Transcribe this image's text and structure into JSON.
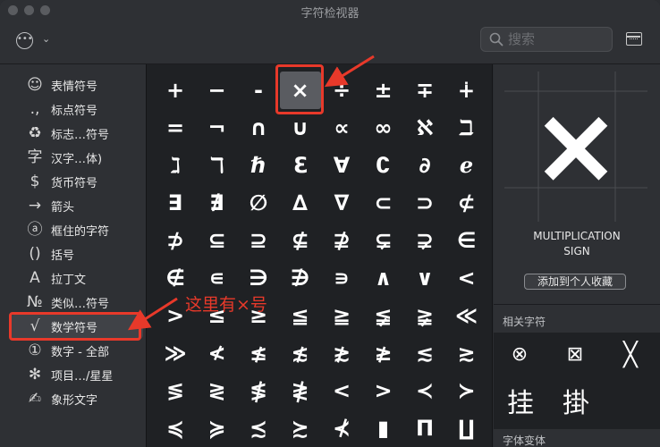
{
  "window": {
    "title": "字符检视器"
  },
  "toolbar": {
    "search_placeholder": "搜索"
  },
  "sidebar": {
    "items": [
      {
        "icon": "☺",
        "label": "表情符号"
      },
      {
        "icon": ".,",
        "label": "标点符号"
      },
      {
        "icon": "♻",
        "label": "标志…符号"
      },
      {
        "icon": "字",
        "label": "汉字…体)"
      },
      {
        "icon": "$",
        "label": "货币符号"
      },
      {
        "icon": "→",
        "label": "箭头"
      },
      {
        "icon": "ⓐ",
        "label": "框住的字符"
      },
      {
        "icon": "()",
        "label": "括号"
      },
      {
        "icon": "A",
        "label": "拉丁文"
      },
      {
        "icon": "№",
        "label": "类似…符号"
      },
      {
        "icon": "√",
        "label": "数学符号"
      },
      {
        "icon": "①",
        "label": "数字 - 全部"
      },
      {
        "icon": "✻",
        "label": "项目…/星星"
      },
      {
        "icon": "✍",
        "label": "象形文字"
      }
    ],
    "selected_index": 10
  },
  "grid": {
    "rows": [
      [
        "+",
        "−",
        "-",
        "×",
        "÷",
        "±",
        "∓",
        "∔"
      ],
      [
        "=",
        "¬",
        "∩",
        "∪",
        "∝",
        "∞",
        "ℵ",
        "ℶ"
      ],
      [
        "ℷ",
        "ℸ",
        "ℏ",
        "ℇ",
        "∀",
        "∁",
        "∂",
        "ℯ"
      ],
      [
        "∃",
        "∄",
        "∅",
        "∆",
        "∇",
        "⊂",
        "⊃",
        "⊄"
      ],
      [
        "⊅",
        "⊆",
        "⊇",
        "⊈",
        "⊉",
        "⊊",
        "⊋",
        "∈"
      ],
      [
        "∉",
        "∊",
        "∋",
        "∌",
        "∍",
        "∧",
        "∨",
        "<"
      ],
      [
        ">",
        "≤",
        "≥",
        "≦",
        "≧",
        "≨",
        "≩",
        "≪"
      ],
      [
        "≫",
        "≮",
        "≰",
        "≴",
        "≵",
        "≱",
        "≲",
        "≳"
      ],
      [
        "≶",
        "≷",
        "≸",
        "≹",
        "<",
        ">",
        "≺",
        "≻"
      ],
      [
        "≼",
        "≽",
        "≾",
        "≿",
        "⊀",
        "▮",
        "Π",
        "∐"
      ]
    ],
    "selected": {
      "row": 0,
      "col": 3
    }
  },
  "annotation": {
    "text": "这里有×号"
  },
  "detail": {
    "preview_char": "×",
    "name_line1": "MULTIPLICATION",
    "name_line2": "SIGN",
    "add_favorite": "添加到个人收藏",
    "related_title": "相关字符",
    "related_chars": [
      "⊗",
      "⊠",
      "╳"
    ],
    "related_cjk": [
      "挂",
      "掛"
    ],
    "variants_title": "字体变体"
  },
  "colors": {
    "highlight": "#e8392a",
    "grid_bg": "#1f2124",
    "panel_bg": "#2e3034"
  }
}
